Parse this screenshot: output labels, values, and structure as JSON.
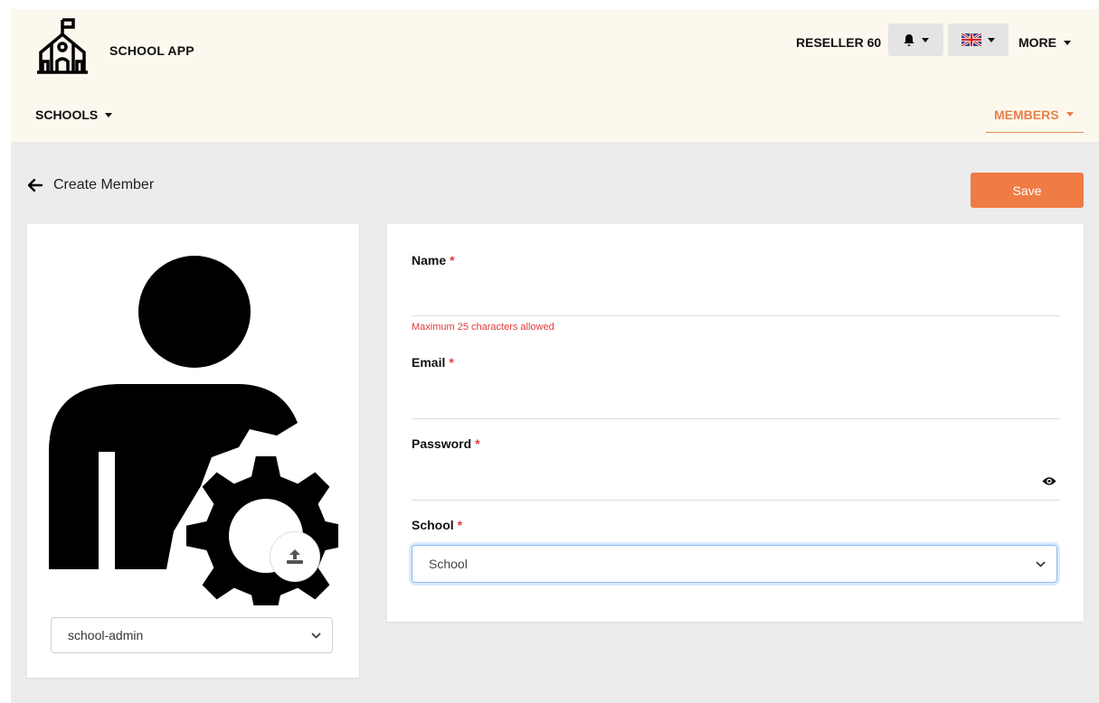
{
  "header": {
    "brand": "SCHOOL APP",
    "reseller": "RESELLER 60",
    "more_label": "MORE",
    "schools_label": "SCHOOLS",
    "members_label": "MEMBERS"
  },
  "page": {
    "title": "Create Member",
    "save_label": "Save"
  },
  "left_card": {
    "role_value": "school-admin"
  },
  "form": {
    "name_label": "Name",
    "name_error": "Maximum 25 characters allowed",
    "email_label": "Email",
    "password_label": "Password",
    "school_label": "School",
    "school_value": "School",
    "required_mark": "*"
  },
  "colors": {
    "accent": "#ef7b45",
    "header_bg": "#fdf8ee",
    "page_bg": "#ececec",
    "error": "#e23b3b"
  }
}
